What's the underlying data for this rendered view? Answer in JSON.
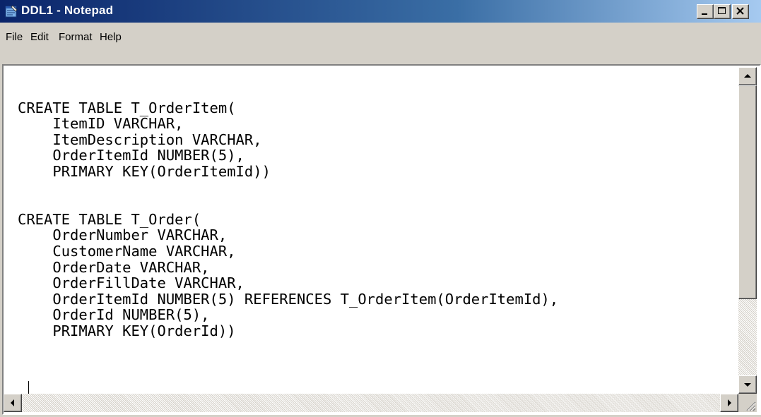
{
  "window": {
    "title": "DDL1 - Notepad",
    "icon": "notepad-icon",
    "controls": [
      "minimize-icon",
      "maximize-icon",
      "close-icon"
    ]
  },
  "menu": {
    "items": [
      {
        "label": "File"
      },
      {
        "label": "Edit"
      },
      {
        "label": "Format"
      },
      {
        "label": "Help"
      }
    ]
  },
  "editor": {
    "content": "\nCREATE TABLE T_OrderItem(\n    ItemID VARCHAR,\n    ItemDescription VARCHAR,\n    OrderItemId NUMBER(5),\n    PRIMARY KEY(OrderItemId))\n\n\nCREATE TABLE T_Order(\n    OrderNumber VARCHAR,\n    CustomerName VARCHAR,\n    OrderDate VARCHAR,\n    OrderFillDate VARCHAR,\n    OrderItemId NUMBER(5) REFERENCES T_OrderItem(OrderItemId),\n    OrderId NUMBER(5),\n    PRIMARY KEY(OrderId))"
  },
  "colors": {
    "titlebar_start": "#0a246a",
    "titlebar_end": "#a6caf0",
    "chrome": "#d4d0c8",
    "editor_bg": "#ffffff"
  }
}
